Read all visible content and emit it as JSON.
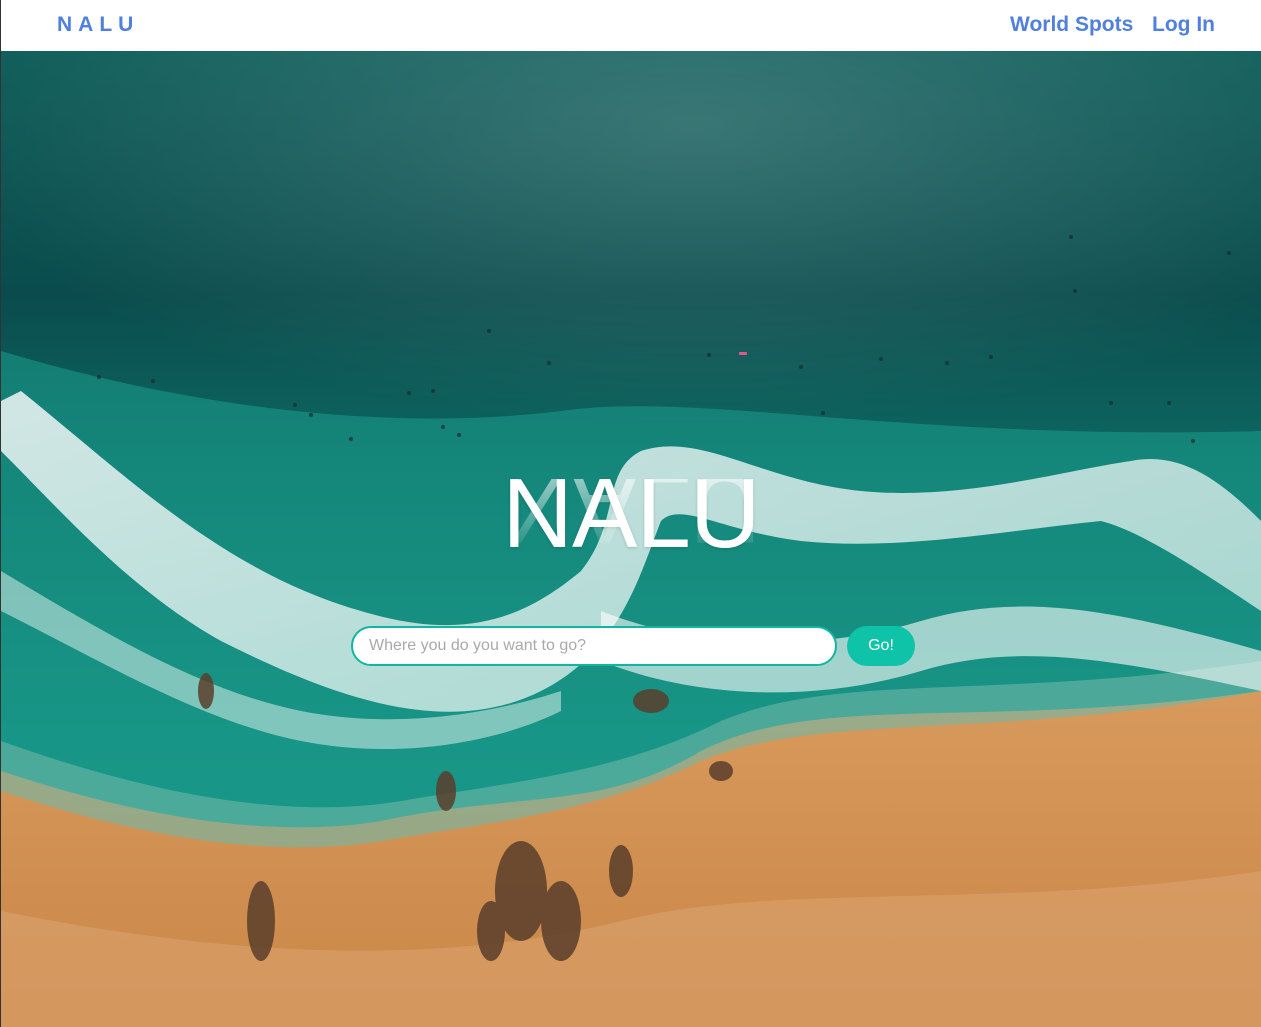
{
  "navbar": {
    "brand": "NALU",
    "links": [
      "World Spots",
      "Log In"
    ]
  },
  "hero": {
    "title": "NALU",
    "search": {
      "placeholder": "Where you do you want to go?",
      "value": ""
    },
    "go_label": "Go!"
  },
  "colors": {
    "brand_blue": "#4f80df",
    "accent_teal": "#0fc3a8",
    "input_border": "#12b5a0"
  }
}
